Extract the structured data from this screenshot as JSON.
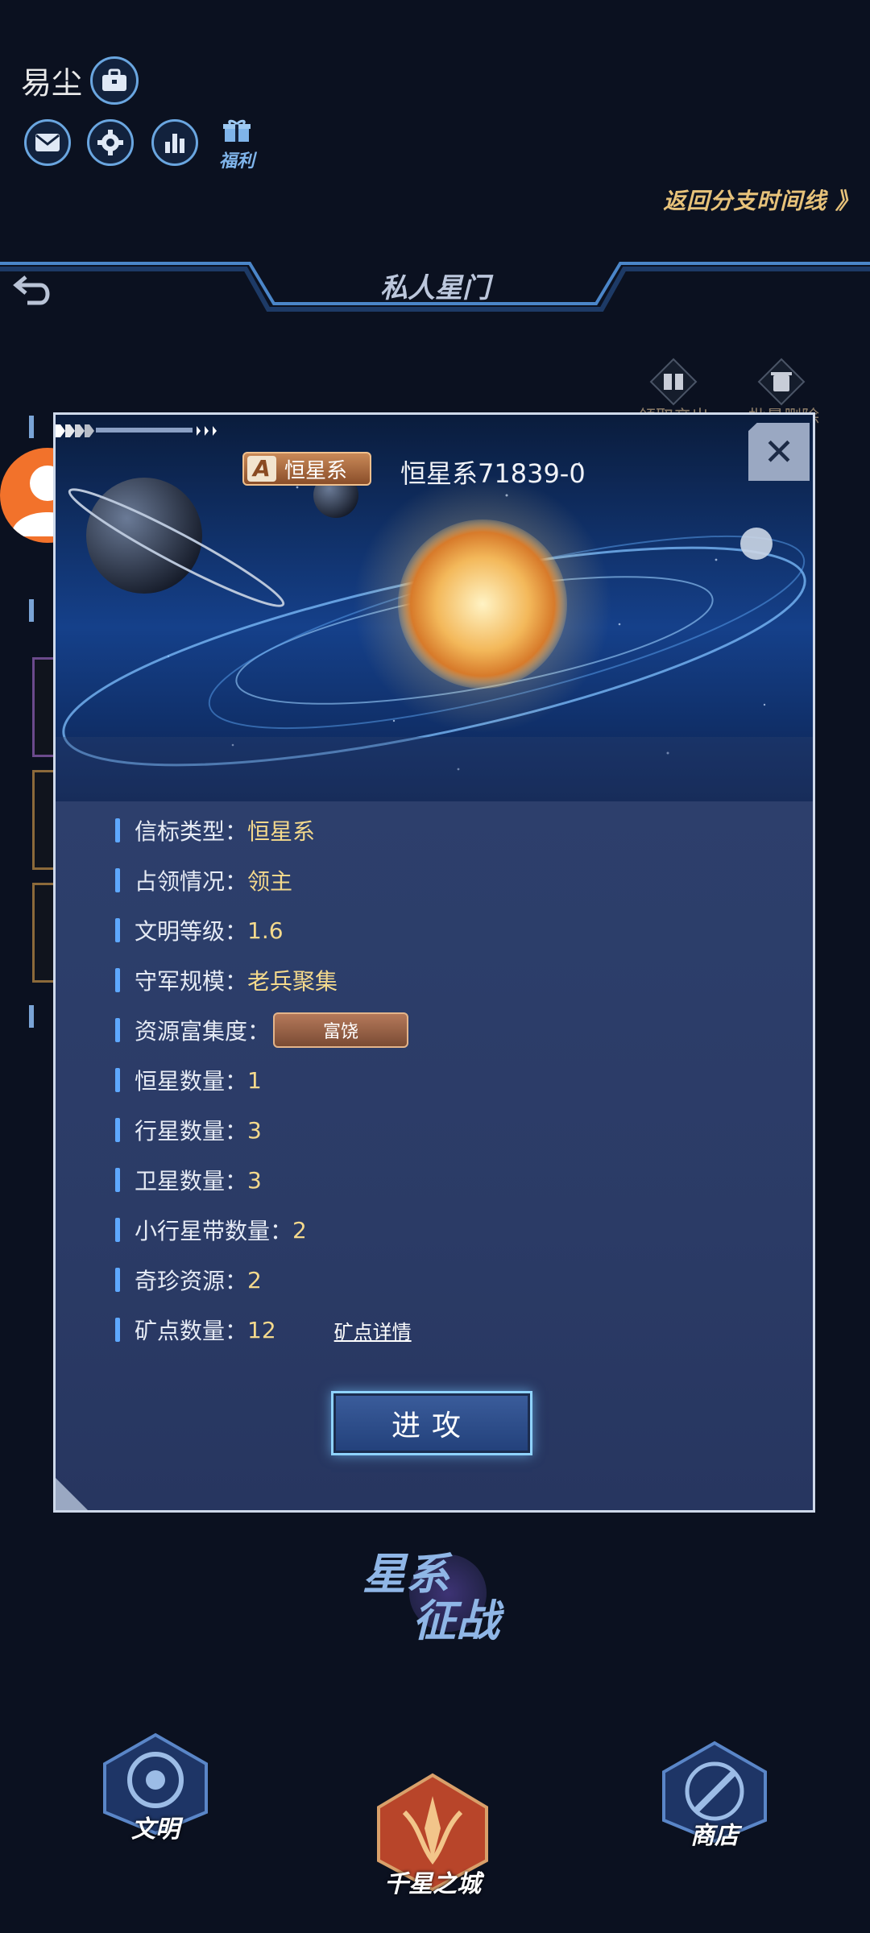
{
  "player": {
    "name": "易尘"
  },
  "top_icons": {
    "benefit_label": "福利"
  },
  "return_branch": "返回分支时间线 》",
  "header": {
    "title": "私人星门"
  },
  "bg_buttons": {
    "collect": "领取产出",
    "batch_delete": "批量删除"
  },
  "modal": {
    "type_tag_letter": "A",
    "type_tag": "恒星系",
    "system_name": "恒星系71839-0",
    "rows": [
      {
        "label": "信标类型：",
        "value": "恒星系"
      },
      {
        "label": "占领情况：",
        "value": "领主"
      },
      {
        "label": "文明等级：",
        "value": "1.6"
      },
      {
        "label": "守军规模：",
        "value": "老兵聚集"
      },
      {
        "label": "资源富集度：",
        "value": "富饶"
      },
      {
        "label": "恒星数量：",
        "value": "1"
      },
      {
        "label": "行星数量：",
        "value": "3"
      },
      {
        "label": "卫星数量：",
        "value": "3"
      },
      {
        "label": "小行星带数量：",
        "value": "2"
      },
      {
        "label": "奇珍资源：",
        "value": "2"
      },
      {
        "label": "矿点数量：",
        "value": "12"
      }
    ],
    "mine_detail_link": "矿点详情",
    "attack_label": "进攻"
  },
  "bottom_logo": {
    "line1": "星系",
    "line2": "征战"
  },
  "bottom_nav": [
    {
      "label": "文明"
    },
    {
      "label": "千星之城"
    },
    {
      "label": "商店"
    }
  ],
  "colors": {
    "accent_gold": "#f4d98c",
    "accent_blue": "#5ea8ff",
    "avatar_orange": "#f2722b"
  }
}
